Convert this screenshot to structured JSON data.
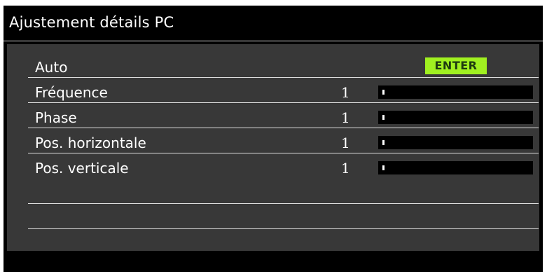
{
  "title": "Ajustement détails PC",
  "colors": {
    "background": "#000000",
    "panel": "#383838",
    "text": "#ffffff",
    "enter_badge": "#a0f020"
  },
  "menu": {
    "items": [
      {
        "label": "Auto",
        "badge": "ENTER"
      },
      {
        "label": "Fréquence",
        "value": "1",
        "level": 0.01
      },
      {
        "label": "Phase",
        "value": "1",
        "level": 0.01
      },
      {
        "label": "Pos. horizontale",
        "value": "1",
        "level": 0.01
      },
      {
        "label": "Pos. verticale",
        "value": "1",
        "level": 0.01
      }
    ]
  }
}
